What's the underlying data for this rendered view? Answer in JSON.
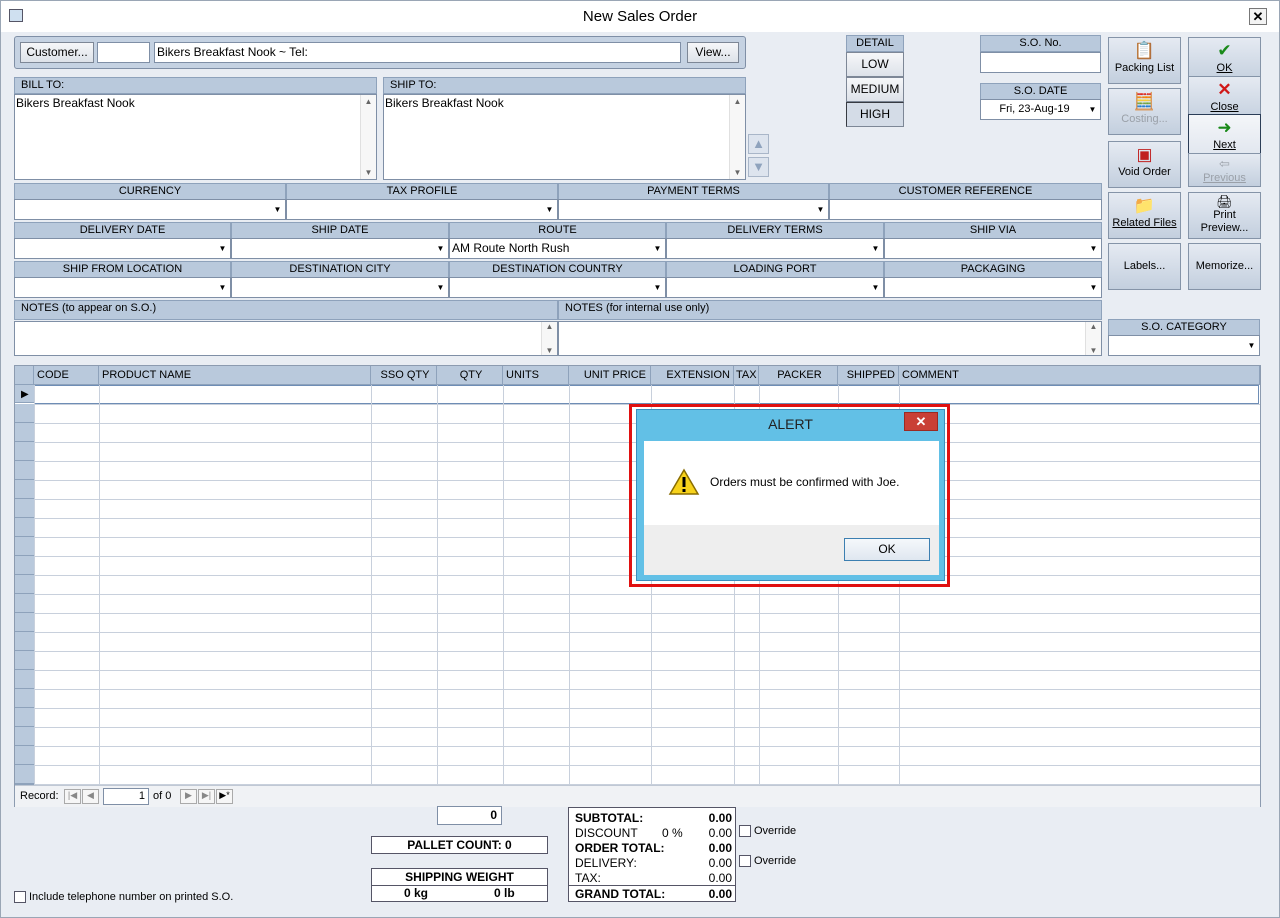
{
  "window": {
    "title": "New Sales Order",
    "close_glyph": "✕"
  },
  "customer": {
    "button": "Customer...",
    "code": "",
    "name": "Bikers Breakfast Nook  ~  Tel:",
    "view_button": "View..."
  },
  "bill_to": {
    "label": "BILL TO:",
    "text": "Bikers Breakfast Nook"
  },
  "ship_to": {
    "label": "SHIP TO:",
    "text": "Bikers Breakfast Nook"
  },
  "detail": {
    "label": "DETAIL",
    "options": [
      "LOW",
      "MEDIUM",
      "HIGH"
    ],
    "selected": "HIGH"
  },
  "so_no": {
    "label": "S.O. No.",
    "value": ""
  },
  "so_date": {
    "label": "S.O. DATE",
    "value": "Fri, 23-Aug-19"
  },
  "side_buttons": {
    "packing_list": "Packing List",
    "ok": "OK",
    "costing": "Costing...",
    "close": "Close",
    "next": "Next",
    "void_order": "Void Order",
    "previous": "Previous",
    "related_files": "Related Files",
    "print_preview": "Print Preview...",
    "labels": "Labels...",
    "memorize": "Memorize..."
  },
  "row1": [
    {
      "label": "CURRENCY",
      "value": ""
    },
    {
      "label": "TAX PROFILE",
      "value": ""
    },
    {
      "label": "PAYMENT TERMS",
      "value": ""
    },
    {
      "label": "CUSTOMER REFERENCE",
      "value": ""
    }
  ],
  "row2": [
    {
      "label": "DELIVERY DATE",
      "value": ""
    },
    {
      "label": "SHIP DATE",
      "value": ""
    },
    {
      "label": "ROUTE",
      "value": "AM Route North Rush"
    },
    {
      "label": "DELIVERY TERMS",
      "value": ""
    },
    {
      "label": "SHIP VIA",
      "value": ""
    }
  ],
  "row3": [
    {
      "label": "SHIP FROM LOCATION",
      "value": ""
    },
    {
      "label": "DESTINATION CITY",
      "value": ""
    },
    {
      "label": "DESTINATION COUNTRY",
      "value": ""
    },
    {
      "label": "LOADING PORT",
      "value": ""
    },
    {
      "label": "PACKAGING",
      "value": ""
    }
  ],
  "notes": {
    "public_label": "NOTES (to appear on S.O.)",
    "internal_label": "NOTES (for internal use only)"
  },
  "so_category": {
    "label": "S.O. CATEGORY",
    "value": ""
  },
  "grid": {
    "columns": [
      "CODE",
      "PRODUCT NAME",
      "SSO QTY",
      "QTY",
      "UNITS",
      "UNIT PRICE",
      "EXTENSION",
      "TAX",
      "PACKER",
      "SHIPPED",
      "COMMENT"
    ]
  },
  "record_nav": {
    "label": "Record:",
    "current": "1",
    "of": "of 0"
  },
  "totals": {
    "qty_total": "0",
    "pallet_count": "PALLET COUNT: 0",
    "shipping_weight_label": "SHIPPING WEIGHT",
    "weight_kg": "0 kg",
    "weight_lb": "0 lb",
    "subtotal_label": "SUBTOTAL:",
    "subtotal": "0.00",
    "discount_label": "DISCOUNT",
    "discount_pct": "0 %",
    "discount": "0.00",
    "order_total_label": "ORDER TOTAL:",
    "order_total": "0.00",
    "delivery_label": "DELIVERY:",
    "delivery": "0.00",
    "tax_label": "TAX:",
    "tax": "0.00",
    "grand_total_label": "GRAND TOTAL:",
    "grand_total": "0.00",
    "override_label": "Override"
  },
  "include_phone": "Include telephone number on printed S.O.",
  "alert": {
    "title": "ALERT",
    "message": "Orders must be confirmed with Joe.",
    "ok_button": "OK",
    "close_glyph": "✕"
  }
}
